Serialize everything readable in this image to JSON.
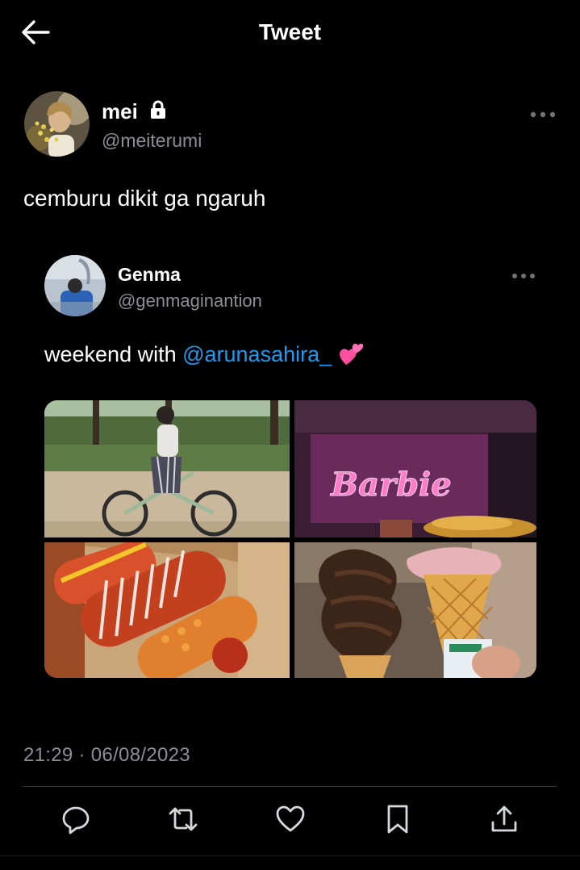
{
  "header": {
    "title": "Tweet"
  },
  "tweet": {
    "author_name": "mei",
    "author_handle": "@meiterumi",
    "text": "cemburu dikit ga ngaruh",
    "timestamp": "21:29 · 06/08/2023"
  },
  "quoted": {
    "author_name": "Genma",
    "author_handle": "@genmaginantion",
    "text_prefix": "weekend with ",
    "mention": "@arunasahira_",
    "emoji_icon": "two-hearts-icon",
    "photos": [
      {
        "label": "bike-in-park-photo"
      },
      {
        "label": "barbie-cinema-screen-photo",
        "sign_text": "Barbie"
      },
      {
        "label": "corn-dogs-photo"
      },
      {
        "label": "ice-cream-cones-photo"
      }
    ]
  },
  "actions": [
    "reply-icon",
    "retweet-icon",
    "like-icon",
    "bookmark-icon",
    "share-icon"
  ],
  "colors": {
    "background": "#000000",
    "link": "#1d9bf0",
    "secondary_text": "#8b8f94",
    "barbie_pink": "#ff3fa8"
  }
}
